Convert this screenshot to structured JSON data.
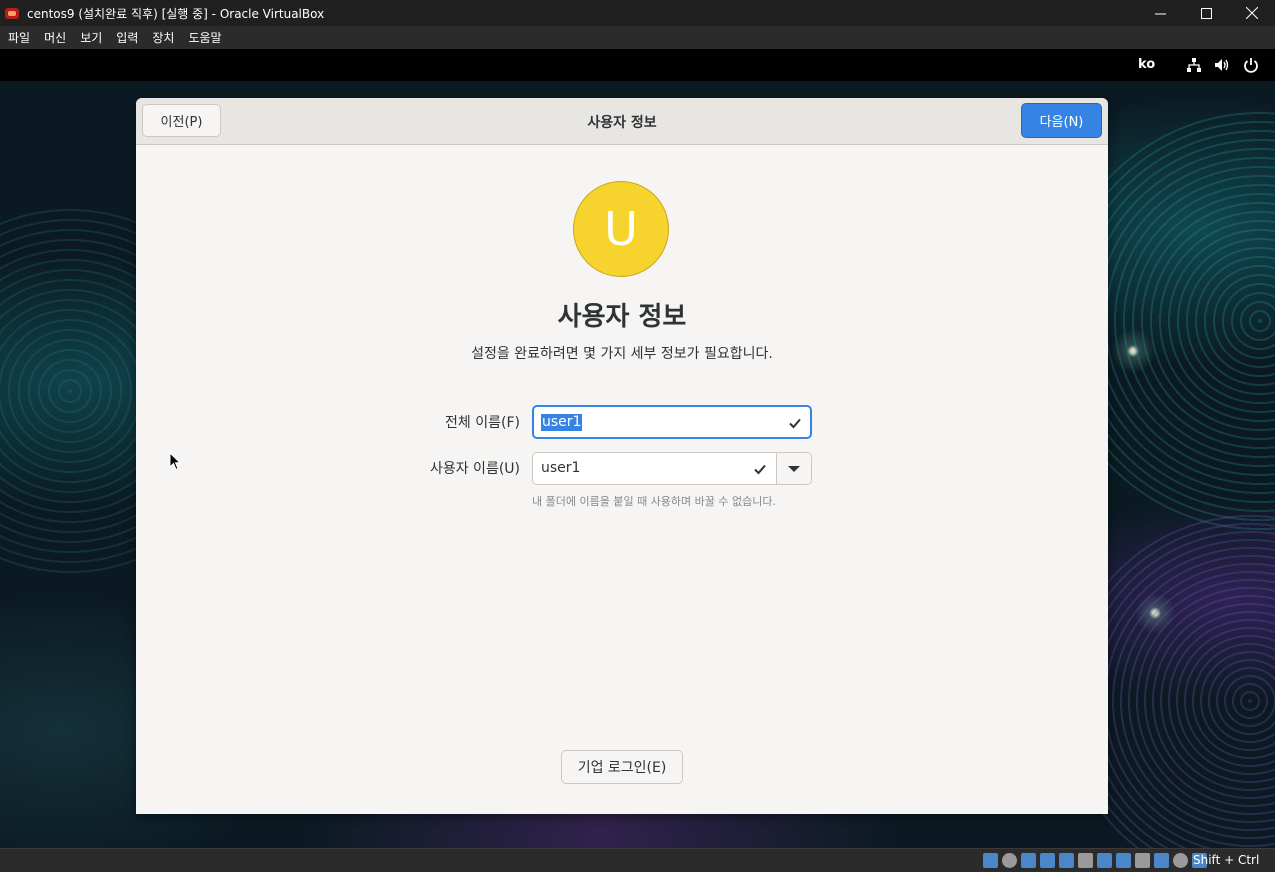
{
  "window": {
    "title": "centos9 (설치완료 직후) [실행 중] - Oracle VirtualBox"
  },
  "menubar": {
    "items": [
      "파일",
      "머신",
      "보기",
      "입력",
      "장치",
      "도움말"
    ]
  },
  "guest_topbar": {
    "language": "ko"
  },
  "setup": {
    "header_title": "사용자 정보",
    "prev_label": "이전(P)",
    "next_label": "다음(N)",
    "avatar_letter": "U",
    "title": "사용자 정보",
    "subtitle": "설정을 완료하려면 몇 가지 세부 정보가 필요합니다.",
    "full_name_label": "전체 이름(F)",
    "full_name_value": "user1",
    "username_label": "사용자 이름(U)",
    "username_value": "user1",
    "username_hint": "내 폴더에 이름을 붙일 때 사용하며 바꿀 수 없습니다.",
    "enterprise_login_label": "기업 로그인(E)"
  },
  "statusbar": {
    "host_key": "Shift + Ctrl"
  },
  "colors": {
    "accent": "#3584e4",
    "avatar": "#f6d32d",
    "window_bg": "#f6f5f4"
  }
}
